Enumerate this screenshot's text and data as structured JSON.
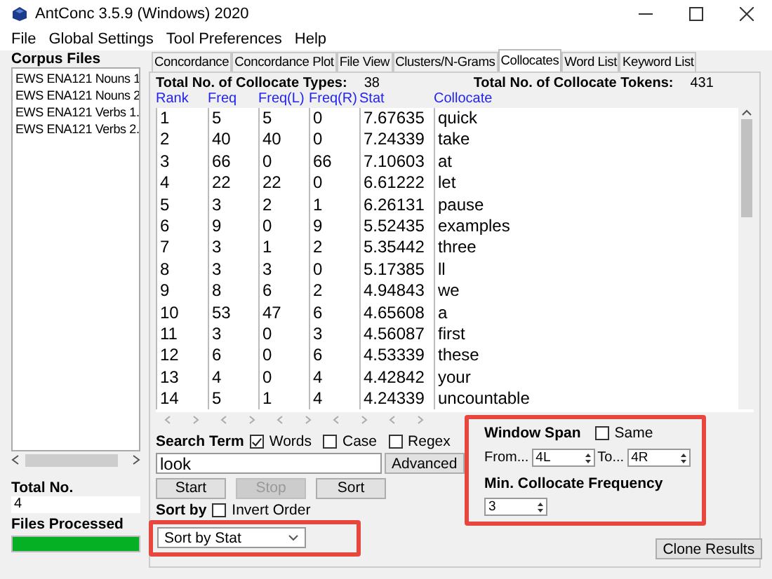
{
  "window": {
    "title": "AntConc 3.5.9 (Windows) 2020"
  },
  "menu": [
    "File",
    "Global Settings",
    "Tool Preferences",
    "Help"
  ],
  "corpus_files": {
    "label": "Corpus Files",
    "items": [
      "EWS ENA121 Nouns 1",
      "EWS ENA121 Nouns 2",
      "EWS ENA121 Verbs 1.",
      "EWS ENA121 Verbs 2."
    ]
  },
  "total_no": {
    "label": "Total No.",
    "value": "4"
  },
  "files_processed": {
    "label": "Files Processed",
    "level": 1
  },
  "tabs": [
    {
      "label": "Concordance",
      "selected": false
    },
    {
      "label": "Concordance Plot",
      "selected": false
    },
    {
      "label": "File View",
      "selected": false
    },
    {
      "label": "Clusters/N-Grams",
      "selected": false
    },
    {
      "label": "Collocates",
      "selected": true
    },
    {
      "label": "Word List",
      "selected": false
    },
    {
      "label": "Keyword List",
      "selected": false
    }
  ],
  "totals": [
    {
      "label": "Total No. of Collocate Types:",
      "value": "38"
    },
    {
      "label": "Total No. of Collocate Tokens:",
      "value": "431"
    }
  ],
  "table": {
    "columns": [
      "Rank",
      "Freq",
      "Freq(L)",
      "Freq(R)",
      "Stat",
      "Collocate"
    ],
    "rows": [
      [
        "1",
        "5",
        "5",
        "0",
        "7.67635",
        "quick"
      ],
      [
        "2",
        "40",
        "40",
        "0",
        "7.24339",
        "take"
      ],
      [
        "3",
        "66",
        "0",
        "66",
        "7.10603",
        "at"
      ],
      [
        "4",
        "22",
        "22",
        "0",
        "6.61222",
        "let"
      ],
      [
        "5",
        "3",
        "2",
        "1",
        "6.26131",
        "pause"
      ],
      [
        "6",
        "9",
        "0",
        "9",
        "5.52435",
        "examples"
      ],
      [
        "7",
        "3",
        "1",
        "2",
        "5.35442",
        "three"
      ],
      [
        "8",
        "3",
        "3",
        "0",
        "5.17385",
        "ll"
      ],
      [
        "9",
        "8",
        "6",
        "2",
        "4.94843",
        "we"
      ],
      [
        "10",
        "53",
        "47",
        "6",
        "4.65608",
        "a"
      ],
      [
        "11",
        "3",
        "0",
        "3",
        "4.56087",
        "first"
      ],
      [
        "12",
        "6",
        "0",
        "6",
        "4.53339",
        "these"
      ],
      [
        "13",
        "4",
        "0",
        "4",
        "4.42842",
        "your"
      ],
      [
        "14",
        "5",
        "1",
        "4",
        "4.24339",
        "uncountable"
      ]
    ]
  },
  "search": {
    "label": "Search Term",
    "options": [
      {
        "label": "Words",
        "checked": true
      },
      {
        "label": "Case",
        "checked": false
      },
      {
        "label": "Regex",
        "checked": false
      }
    ],
    "value": "look",
    "advanced": "Advanced"
  },
  "buttons": [
    {
      "label": "Start",
      "disabled": false
    },
    {
      "label": "Stop",
      "disabled": true
    },
    {
      "label": "Sort",
      "disabled": false
    }
  ],
  "sort": {
    "label": "Sort by",
    "invert": {
      "label": "Invert Order",
      "checked": false
    },
    "value": "Sort by Stat",
    "highlighted": true
  },
  "window_span": {
    "label": "Window Span",
    "same": {
      "label": "Same",
      "checked": false
    },
    "from_label": "From...",
    "from": "4L",
    "to_label": "To...",
    "to": "4R",
    "min_freq_label": "Min. Collocate Frequency",
    "min_freq": "3",
    "highlighted": true
  },
  "clone_button": "Clone Results"
}
